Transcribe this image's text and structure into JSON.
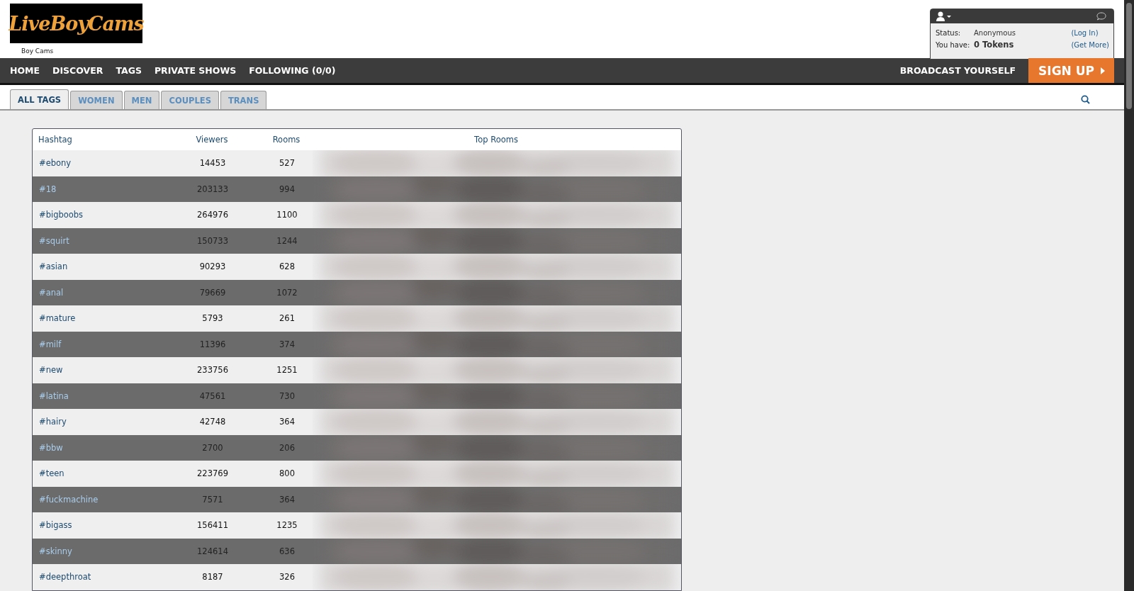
{
  "logo": {
    "text": "LiveBoyCams",
    "caption": "Boy Cams"
  },
  "user_panel": {
    "status_label": "Status:",
    "status_value": "Anonymous",
    "login_link": "(Log In)",
    "tokens_label": "You have:",
    "tokens_value": "0 Tokens",
    "get_more_link": "(Get More)"
  },
  "nav": {
    "items": [
      "HOME",
      "DISCOVER",
      "TAGS",
      "PRIVATE SHOWS",
      "FOLLOWING (0/0)"
    ],
    "broadcast": "BROADCAST YOURSELF",
    "signup": "SIGN UP"
  },
  "tabs": [
    {
      "label": "ALL TAGS",
      "selected": true
    },
    {
      "label": "WOMEN",
      "selected": false
    },
    {
      "label": "MEN",
      "selected": false
    },
    {
      "label": "COUPLES",
      "selected": false
    },
    {
      "label": "TRANS",
      "selected": false
    }
  ],
  "table": {
    "columns": [
      "Hashtag",
      "Viewers",
      "Rooms",
      "Top Rooms"
    ],
    "rows": [
      {
        "hashtag": "#ebony",
        "viewers": "14453",
        "rooms": "527"
      },
      {
        "hashtag": "#18",
        "viewers": "203133",
        "rooms": "994"
      },
      {
        "hashtag": "#bigboobs",
        "viewers": "264976",
        "rooms": "1100"
      },
      {
        "hashtag": "#squirt",
        "viewers": "150733",
        "rooms": "1244"
      },
      {
        "hashtag": "#asian",
        "viewers": "90293",
        "rooms": "628"
      },
      {
        "hashtag": "#anal",
        "viewers": "79669",
        "rooms": "1072"
      },
      {
        "hashtag": "#mature",
        "viewers": "5793",
        "rooms": "261"
      },
      {
        "hashtag": "#milf",
        "viewers": "11396",
        "rooms": "374"
      },
      {
        "hashtag": "#new",
        "viewers": "233756",
        "rooms": "1251"
      },
      {
        "hashtag": "#latina",
        "viewers": "47561",
        "rooms": "730"
      },
      {
        "hashtag": "#hairy",
        "viewers": "42748",
        "rooms": "364"
      },
      {
        "hashtag": "#bbw",
        "viewers": "2700",
        "rooms": "206"
      },
      {
        "hashtag": "#teen",
        "viewers": "223769",
        "rooms": "800"
      },
      {
        "hashtag": "#fuckmachine",
        "viewers": "7571",
        "rooms": "364"
      },
      {
        "hashtag": "#bigass",
        "viewers": "156411",
        "rooms": "1235"
      },
      {
        "hashtag": "#skinny",
        "viewers": "124614",
        "rooms": "636"
      },
      {
        "hashtag": "#deepthroat",
        "viewers": "8187",
        "rooms": "326"
      }
    ]
  }
}
